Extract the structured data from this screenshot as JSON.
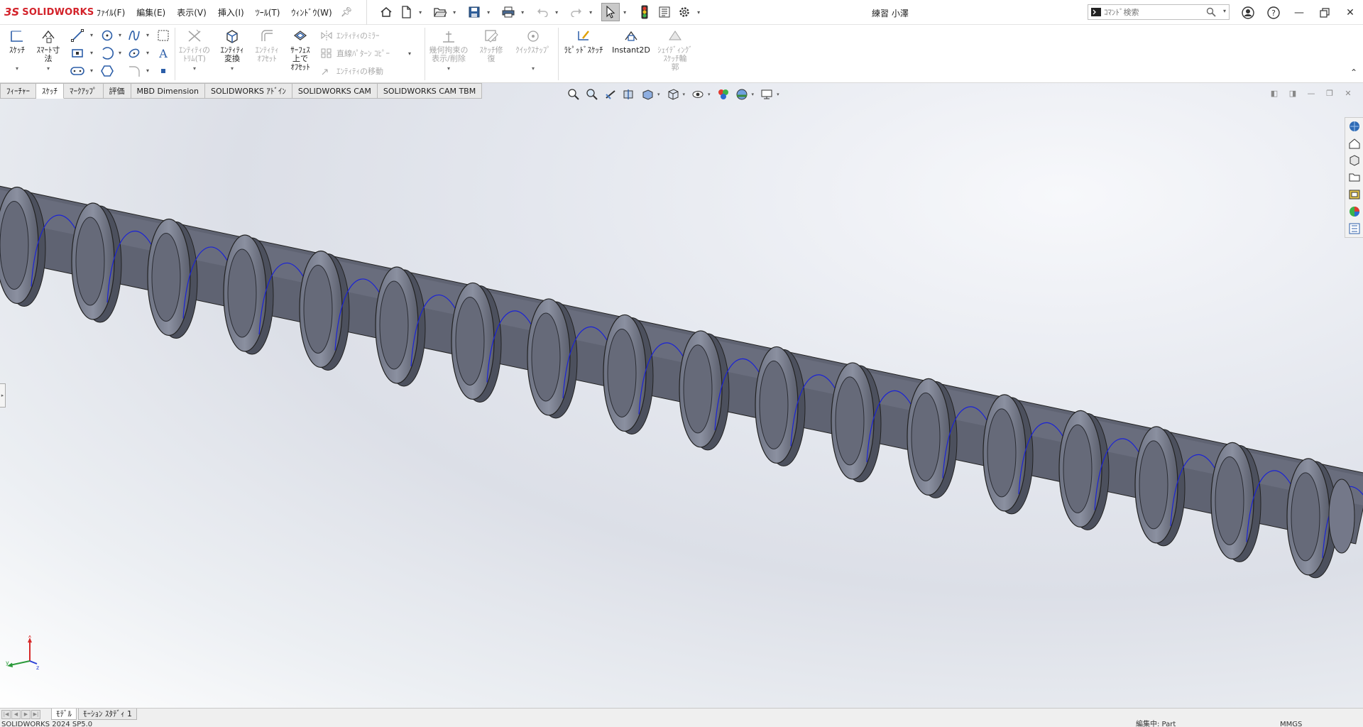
{
  "app": {
    "logo_mark": "3S",
    "logo_name": "SOLIDWORKS",
    "document_title": "練習 小澤"
  },
  "menu": [
    "ﾌｧｲﾙ(F)",
    "編集(E)",
    "表示(V)",
    "挿入(I)",
    "ﾂｰﾙ(T)",
    "ｳｨﾝﾄﾞｳ(W)"
  ],
  "search": {
    "placeholder": "ｺﾏﾝﾄﾞ検索"
  },
  "ribbon": {
    "sketch": "ｽｹｯﾁ",
    "smart_dimension": "ｽﾏｰﾄ寸\n法",
    "trim": "ｴﾝﾃｨﾃｨの\nﾄﾘﾑ(T)",
    "convert": "ｴﾝﾃｨﾃｨ\n変換",
    "offset": "ｴﾝﾃｨﾃｨ\nｵﾌｾｯﾄ",
    "surface_offset": "ｻｰﾌｪｽ\n上で\nｵﾌｾｯﾄ",
    "mirror": "ｴﾝﾃｨﾃｨのﾐﾗｰ",
    "linear_pattern": "直線ﾊﾟﾀｰﾝ ｺﾋﾟｰ",
    "move": "ｴﾝﾃｨﾃｨの移動",
    "relations": "幾何拘束の\n表示/削除",
    "repair": "ｽｹｯﾁ修\n復",
    "quick_snap": "ｸｲｯｸｽﾅｯﾌﾟ",
    "rapid_sketch": "ﾗﾋﾟｯﾄﾞｽｹｯﾁ",
    "instant2d": "Instant2D",
    "shaded_sketch": "ｼｪｲﾃﾞｨﾝｸﾞ\nｽｹｯﾁ輪\n郭"
  },
  "tabs": [
    {
      "label": "ﾌｨｰﾁｬｰ",
      "active": false
    },
    {
      "label": "ｽｹｯﾁ",
      "active": true
    },
    {
      "label": "ﾏｰｸｱｯﾌﾟ",
      "active": false
    },
    {
      "label": "評価",
      "active": false
    },
    {
      "label": "MBD Dimension",
      "active": false
    },
    {
      "label": "SOLIDWORKS ｱﾄﾞｲﾝ",
      "active": false
    },
    {
      "label": "SOLIDWORKS CAM",
      "active": false
    },
    {
      "label": "SOLIDWORKS CAM TBM",
      "active": false
    }
  ],
  "bottom_tabs": [
    {
      "label": "ﾓﾃﾞﾙ",
      "active": true
    },
    {
      "label": "ﾓｰｼｮﾝ ｽﾀﾃﾞｨ 1",
      "active": false
    }
  ],
  "status": {
    "version": "SOLIDWORKS 2024 SP5.0",
    "editing": "編集中: Part",
    "units": "MMGS"
  },
  "triad": {
    "x": "x",
    "y": "y",
    "z": "z"
  },
  "colors": {
    "brand_red": "#d3222a",
    "model_body": "#5f6372",
    "helix": "#1a22d6"
  }
}
